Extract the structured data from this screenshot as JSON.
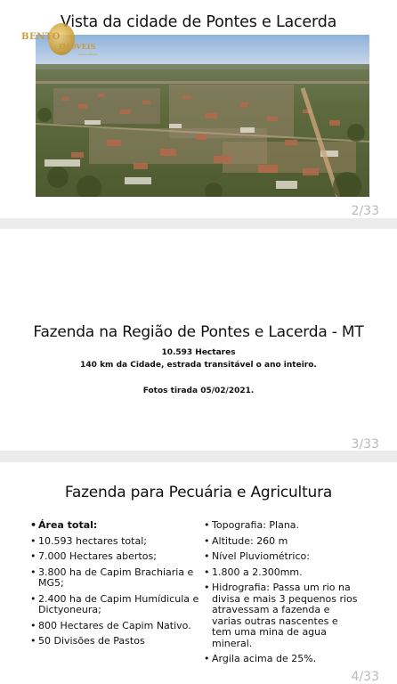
{
  "slides": [
    {
      "title": "Vista da cidade de Pontes e Lacerda",
      "page": "2/33",
      "logo": {
        "line1": "BENTO",
        "line2": "IMÓVEIS",
        "line3": "desde sempre"
      }
    },
    {
      "title": "Fazenda na Região de Pontes e Lacerda - MT",
      "lines": [
        "10.593 Hectares",
        "140 km da Cidade, estrada transitável o ano inteiro.",
        "Fotos tirada 05/02/2021."
      ],
      "page": "3/33"
    },
    {
      "title": "Fazenda para Pecuária e Agricultura",
      "left_items": [
        "Área total:",
        "10.593 hectares total;",
        "7.000 Hectares abertos;",
        "3.800 ha de Capim Brachiaria e MG5;",
        "2.400 ha de Capim Humídicula e Dictyoneura;",
        "800 Hectares de Capim Nativo.",
        "50 Divisões de Pastos"
      ],
      "right_items": [
        "Topografia: Plana.",
        "Altitude: 260 m",
        "Nível Pluviométrico:",
        "1.800 a 2.300mm.",
        "Hidrografia: Passa um rio na divisa e mais 3 pequenos rios atravessam a fazenda e varias outras nascentes e tem uma mina de agua mineral.",
        "Argila acima de 25%."
      ],
      "page": "4/33"
    }
  ]
}
